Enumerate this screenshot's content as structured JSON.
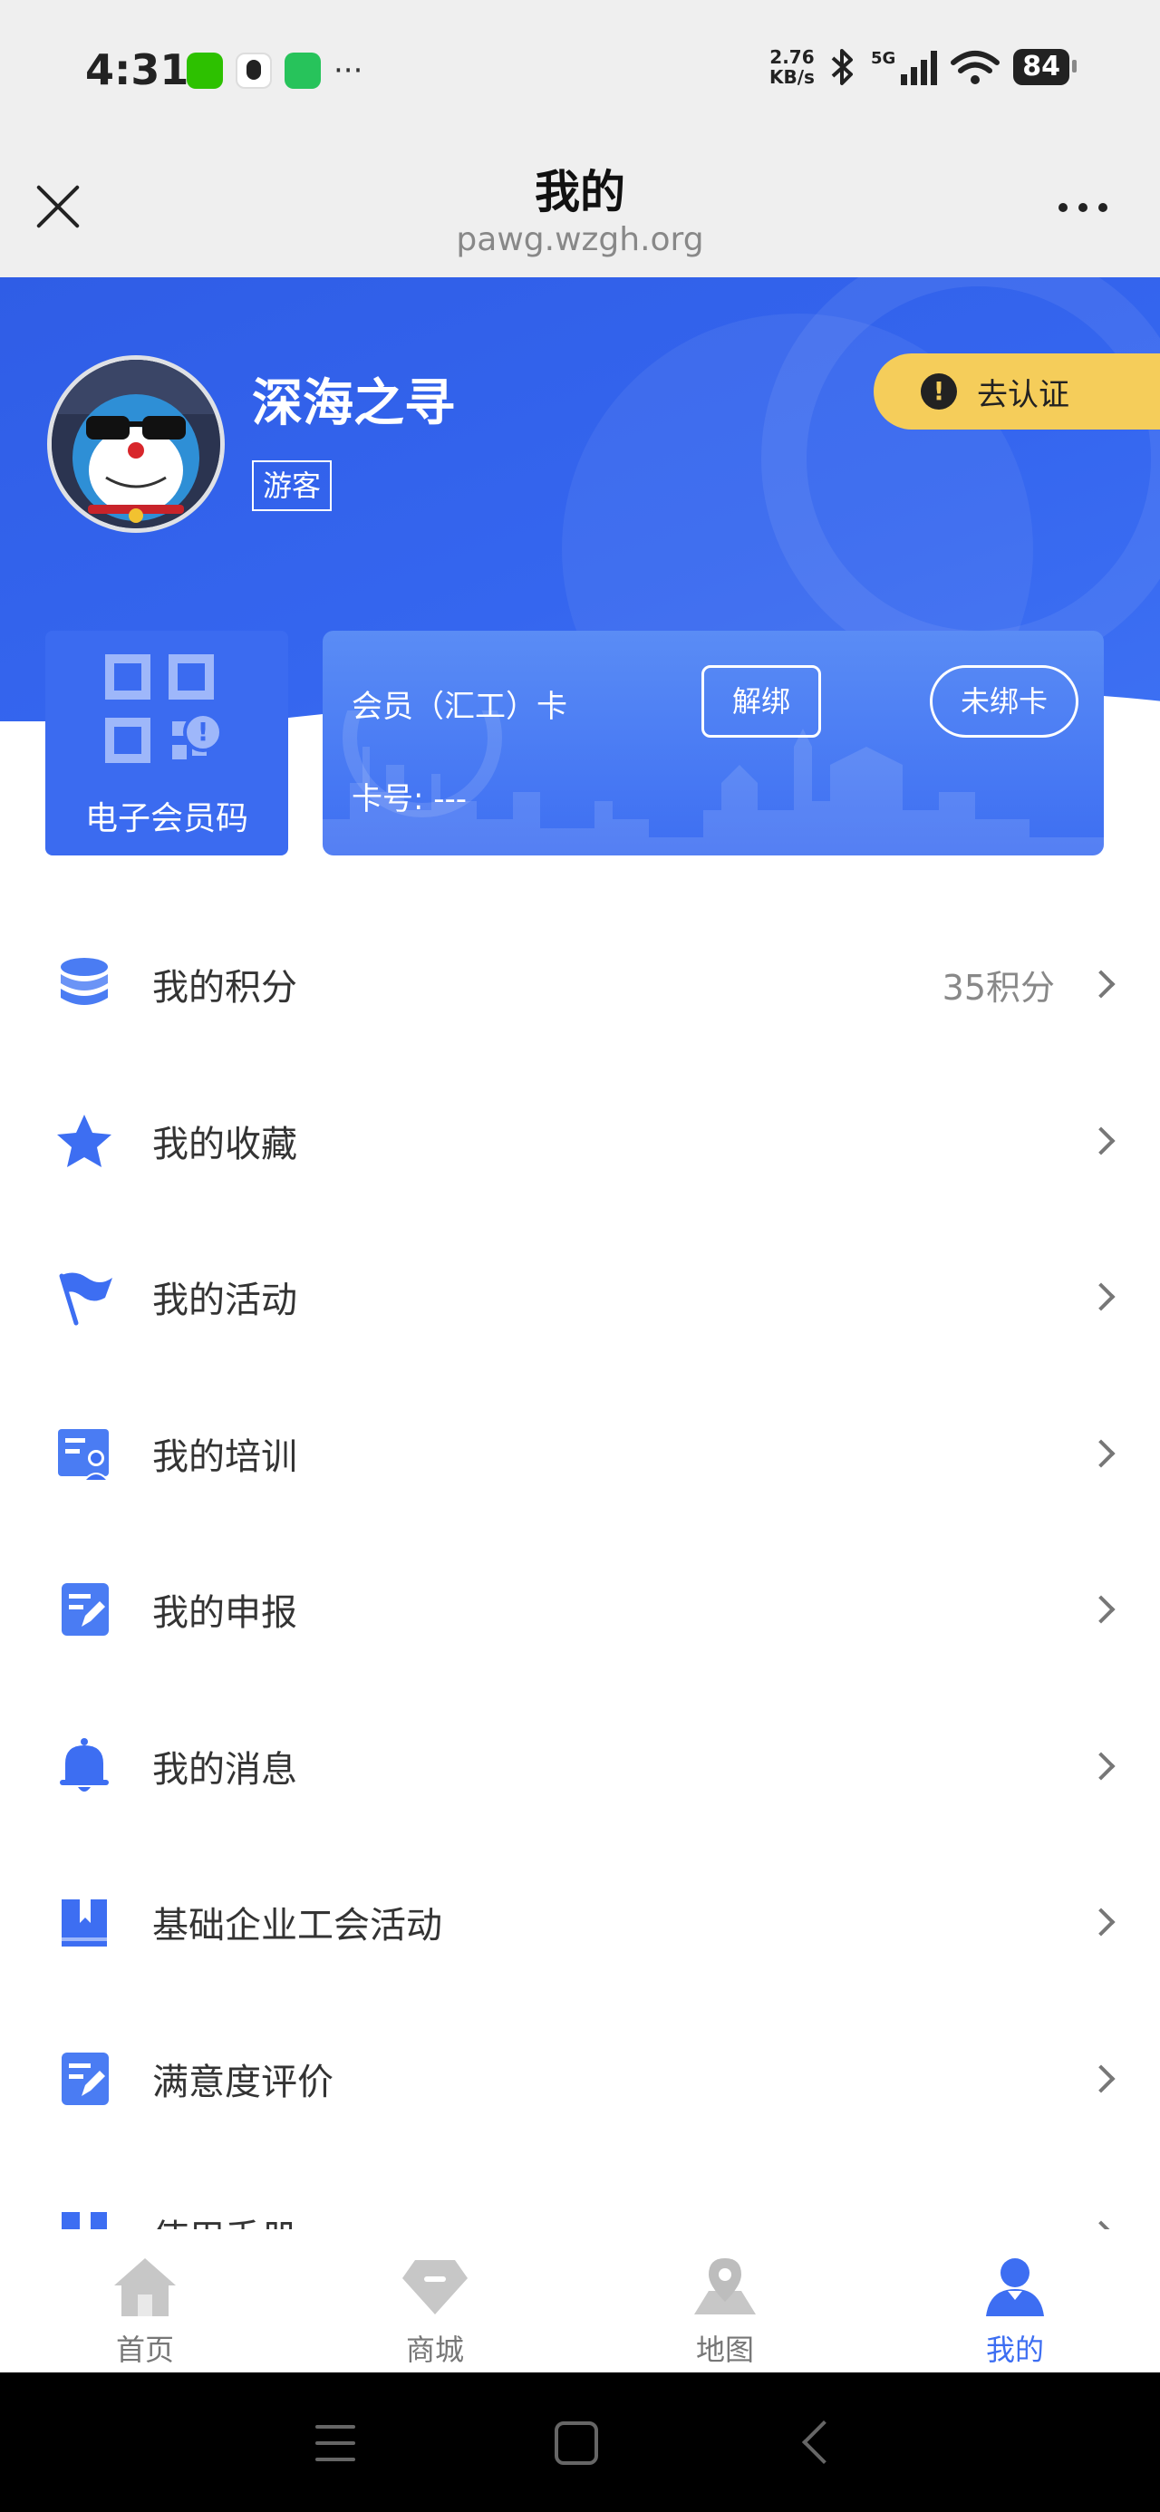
{
  "status_bar": {
    "time": "4:31",
    "speed_value": "2.76",
    "speed_unit": "KB/s",
    "network_type": "5G",
    "battery": "84",
    "apps": [
      "wechat-icon",
      "qq-icon",
      "messages-icon"
    ],
    "more": "···"
  },
  "title_bar": {
    "title": "我的",
    "url": "pawg.wzgh.org"
  },
  "profile": {
    "name": "深海之寻",
    "role": "游客",
    "verify_label": "去认证",
    "verify_icon_text": "!"
  },
  "qr_card": {
    "label": "电子会员码",
    "badge": "!"
  },
  "member_card": {
    "title": "会员（汇工）卡",
    "unbind_label": "解绑",
    "bind_status": "未绑卡",
    "card_number": "卡号: ---"
  },
  "menu": {
    "items": [
      {
        "label": "我的积分",
        "value": "35积分",
        "icon": "coins-stack-icon"
      },
      {
        "label": "我的收藏",
        "value": "",
        "icon": "star-icon"
      },
      {
        "label": "我的活动",
        "value": "",
        "icon": "flag-icon"
      },
      {
        "label": "我的培训",
        "value": "",
        "icon": "training-icon"
      },
      {
        "label": "我的申报",
        "value": "",
        "icon": "edit-document-icon"
      },
      {
        "label": "我的消息",
        "value": "",
        "icon": "bell-icon"
      },
      {
        "label": "基础企业工会活动",
        "value": "",
        "icon": "book-icon"
      },
      {
        "label": "满意度评价",
        "value": "",
        "icon": "edit-document-icon"
      },
      {
        "label": "使用手册",
        "value": "",
        "icon": "book-icon"
      }
    ]
  },
  "bottom_nav": {
    "items": [
      {
        "label": "首页",
        "icon": "home-icon",
        "active": false
      },
      {
        "label": "商城",
        "icon": "diamond-icon",
        "active": false
      },
      {
        "label": "地图",
        "icon": "map-pin-icon",
        "active": false
      },
      {
        "label": "我的",
        "icon": "user-icon",
        "active": true
      }
    ]
  },
  "colors": {
    "primary": "#3d6ef2",
    "verify_bg": "#f5cd5a",
    "hero_bg": "#3566ef"
  }
}
